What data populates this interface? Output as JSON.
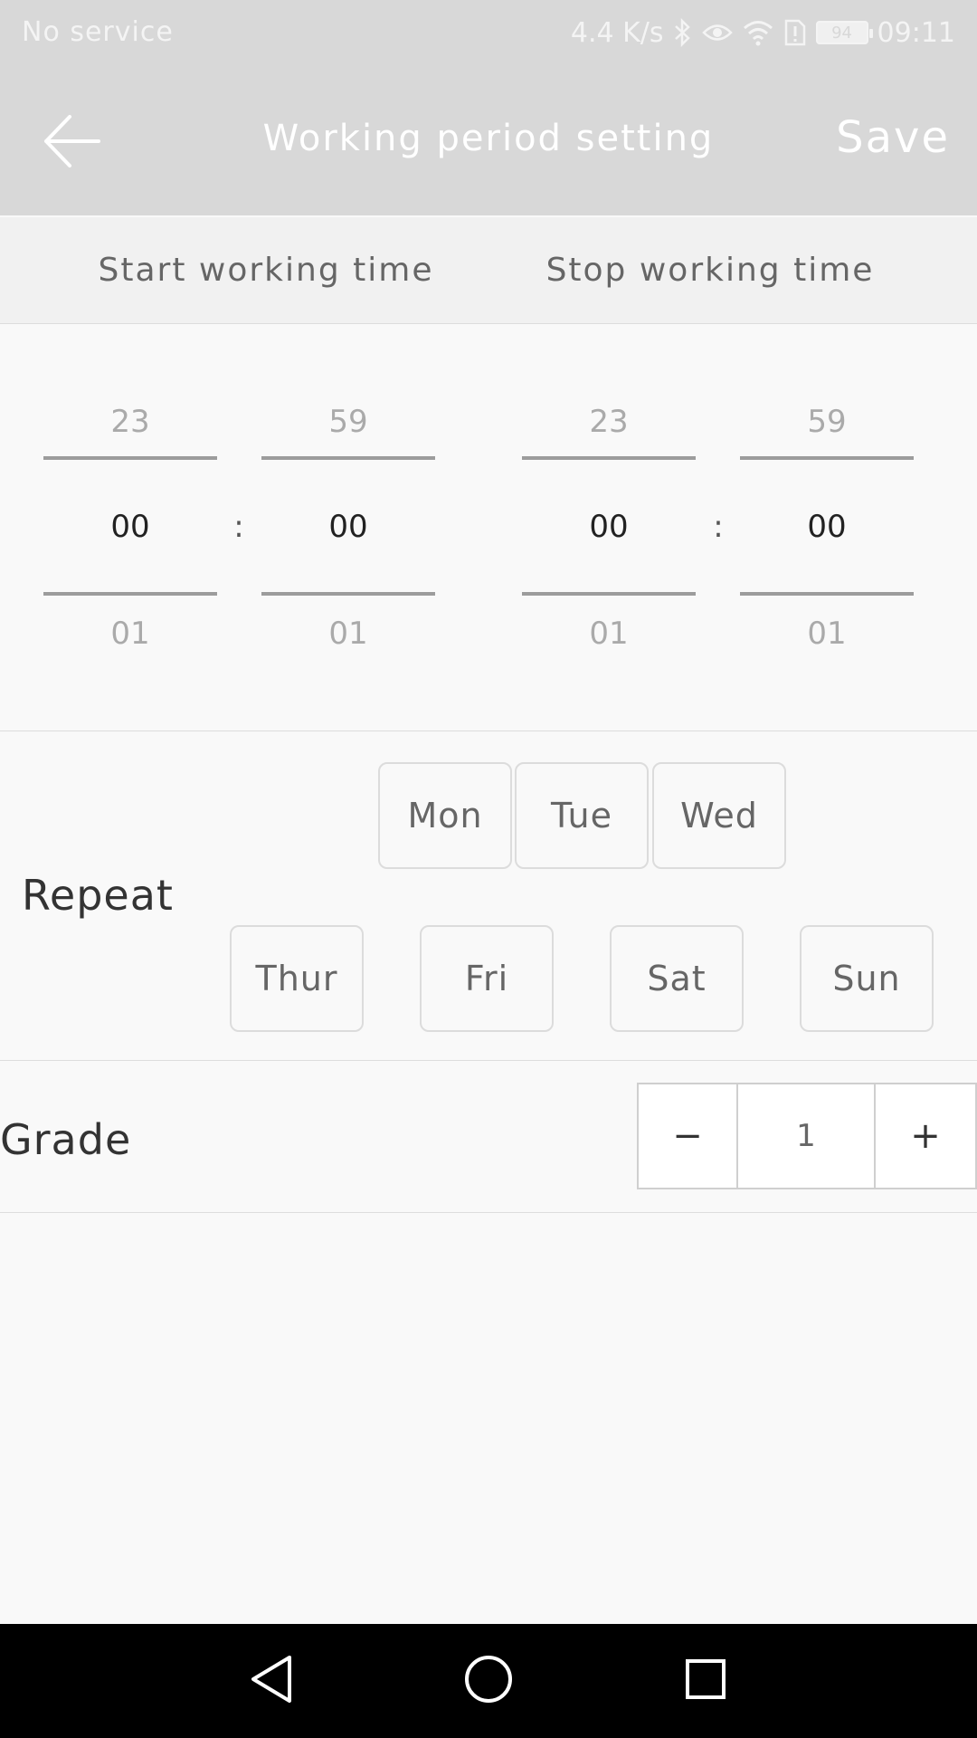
{
  "status_bar": {
    "carrier": "No service",
    "speed": "4.4 K/s",
    "battery": "94",
    "time": "09:11",
    "icons": [
      "bluetooth-icon",
      "eye-icon",
      "wifi-icon",
      "alert-icon",
      "battery-icon"
    ]
  },
  "app_bar": {
    "title": "Working period setting",
    "save_label": "Save",
    "back_icon": "arrow-left-icon"
  },
  "time_header": {
    "start_label": "Start working time",
    "stop_label": "Stop working time"
  },
  "pickers": {
    "start_hour": {
      "prev": "23",
      "current": "00",
      "next": "01"
    },
    "start_minute": {
      "prev": "59",
      "current": "00",
      "next": "01"
    },
    "stop_hour": {
      "prev": "23",
      "current": "00",
      "next": "01"
    },
    "stop_minute": {
      "prev": "59",
      "current": "00",
      "next": "01"
    },
    "separator": ":"
  },
  "repeat": {
    "label": "Repeat",
    "days": [
      "Mon",
      "Tue",
      "Wed",
      "Thur",
      "Fri",
      "Sat",
      "Sun"
    ]
  },
  "grade": {
    "label": "Grade",
    "minus": "−",
    "value": "1",
    "plus": "+"
  },
  "nav_bar": {
    "icons": [
      "back-triangle-icon",
      "home-circle-icon",
      "recents-square-icon"
    ]
  },
  "colors": {
    "app_bar": "#d8d8d8",
    "background": "#f9f9f9",
    "header_bg": "#f1f1f1",
    "nav_bar": "#000000"
  }
}
